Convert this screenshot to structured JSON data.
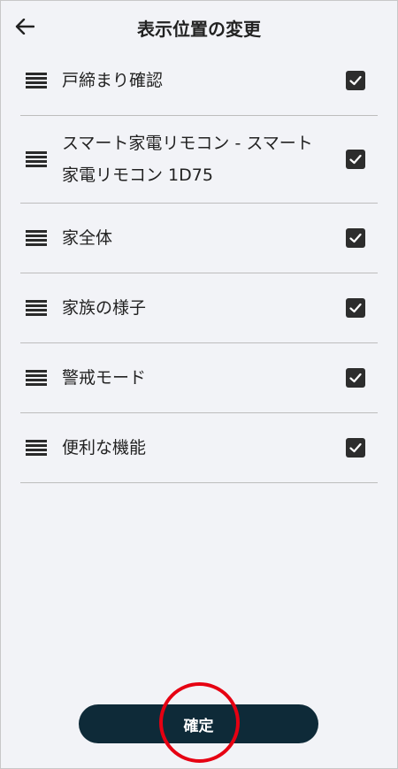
{
  "header": {
    "back_icon": "arrow-left-icon",
    "title": "表示位置の変更"
  },
  "items": [
    {
      "label": "戸締まり確認",
      "checked": true
    },
    {
      "label": "スマート家電リモコン - スマート家電リモコン 1D75",
      "checked": true
    },
    {
      "label": "家全体",
      "checked": true
    },
    {
      "label": "家族の様子",
      "checked": true
    },
    {
      "label": "警戒モード",
      "checked": true
    },
    {
      "label": "便利な機能",
      "checked": true
    }
  ],
  "confirm": {
    "label": "確定"
  },
  "colors": {
    "background": "#f2f3f7",
    "button": "#0e2a38",
    "checkbox": "#2d2d2d",
    "highlight": "#e60012"
  }
}
